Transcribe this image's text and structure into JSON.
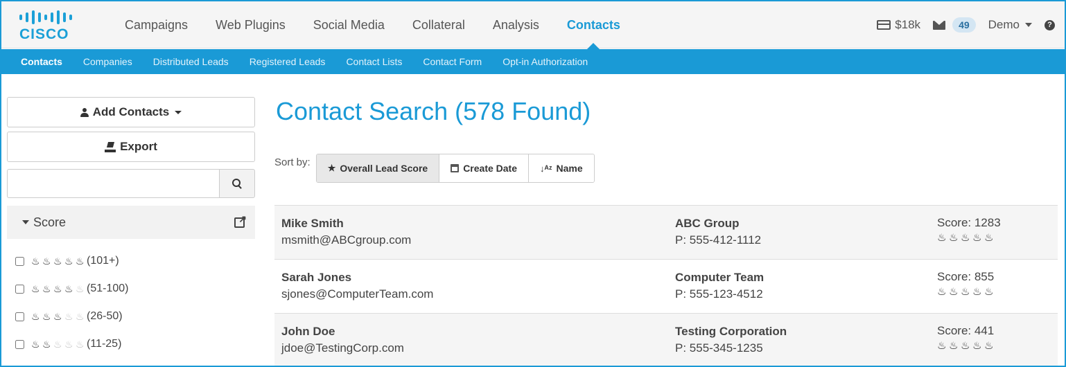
{
  "brand": {
    "logo_text": "CISCO"
  },
  "nav": {
    "items": [
      {
        "label": "Campaigns",
        "active": false
      },
      {
        "label": "Web Plugins",
        "active": false
      },
      {
        "label": "Social Media",
        "active": false
      },
      {
        "label": "Collateral",
        "active": false
      },
      {
        "label": "Analysis",
        "active": false
      },
      {
        "label": "Contacts",
        "active": true
      }
    ],
    "credit": "$18k",
    "mail_count": "49",
    "user": "Demo",
    "help_icon": "question-circle-icon"
  },
  "subnav": {
    "items": [
      {
        "label": "Contacts",
        "active": true
      },
      {
        "label": "Companies",
        "active": false
      },
      {
        "label": "Distributed Leads",
        "active": false
      },
      {
        "label": "Registered Leads",
        "active": false
      },
      {
        "label": "Contact Lists",
        "active": false
      },
      {
        "label": "Contact Form",
        "active": false
      },
      {
        "label": "Opt-in Authorization",
        "active": false
      }
    ]
  },
  "sidebar": {
    "add_contacts_label": "Add Contacts",
    "export_label": "Export",
    "search_value": "",
    "search_placeholder": "",
    "facet_title": "Score",
    "score_filters": [
      {
        "range": "(101+)",
        "flames": 5,
        "checked": false
      },
      {
        "range": "(51-100)",
        "flames": 4,
        "checked": false
      },
      {
        "range": "(26-50)",
        "flames": 3,
        "checked": false
      },
      {
        "range": "(11-25)",
        "flames": 2,
        "checked": false
      }
    ]
  },
  "main": {
    "title": "Contact Search  (578 Found)",
    "sort_label": "Sort by:",
    "sort_options": [
      {
        "label": "Overall Lead Score",
        "icon": "star-icon",
        "active": true
      },
      {
        "label": "Create Date",
        "icon": "calendar-icon",
        "active": false
      },
      {
        "label": "Name",
        "icon": "sort-alpha-icon",
        "active": false
      }
    ],
    "contacts": [
      {
        "name": "Mike Smith",
        "email": "msmith@ABCgroup.com",
        "company": "ABC Group",
        "phone": "P: 555-412-1112",
        "score": "Score: 1283",
        "flames": 5
      },
      {
        "name": "Sarah Jones",
        "email": "sjones@ComputerTeam.com",
        "company": "Computer Team",
        "phone": "P: 555-123-4512",
        "score": "Score: 855",
        "flames": 5
      },
      {
        "name": "John Doe",
        "email": "jdoe@TestingCorp.com",
        "company": "Testing Corporation",
        "phone": "P: 555-345-1235",
        "score": "Score: 441",
        "flames": 5
      }
    ]
  },
  "colors": {
    "accent": "#1a9ad6",
    "subnav_bg": "#1a9ad6"
  }
}
